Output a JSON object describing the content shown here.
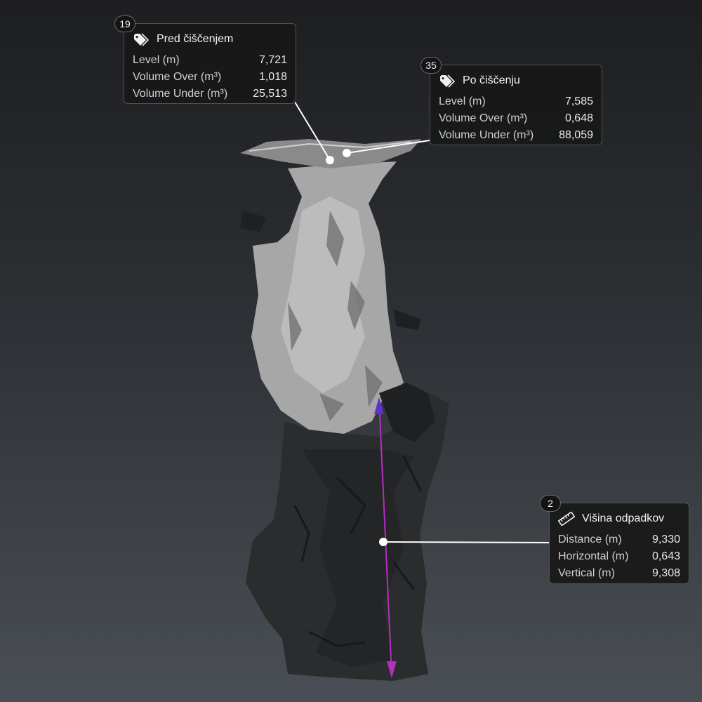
{
  "callouts": [
    {
      "badge": "19",
      "icon": "tag-icon",
      "title": "Pred čiščenjem",
      "rows": [
        {
          "label": "Level (m)",
          "value": "7,721"
        },
        {
          "label": "Volume Over (m³)",
          "value": "1,018"
        },
        {
          "label": "Volume Under (m³)",
          "value": "25,513"
        }
      ]
    },
    {
      "badge": "35",
      "icon": "tag-icon",
      "title": "Po čiščenju",
      "rows": [
        {
          "label": "Level (m)",
          "value": "7,585"
        },
        {
          "label": "Volume Over (m³)",
          "value": "0,648"
        },
        {
          "label": "Volume Under (m³)",
          "value": "88,059"
        }
      ]
    },
    {
      "badge": "2",
      "icon": "ruler-icon",
      "title": "Višina odpadkov",
      "rows": [
        {
          "label": "Distance (m)",
          "value": "9,330"
        },
        {
          "label": "Horizontal (m)",
          "value": "0,643"
        },
        {
          "label": "Vertical (m)",
          "value": "9,308"
        }
      ]
    }
  ],
  "colors": {
    "measure_line": "#b030c0",
    "measure_arrow": "#6030d0",
    "leader": "#ffffff"
  }
}
